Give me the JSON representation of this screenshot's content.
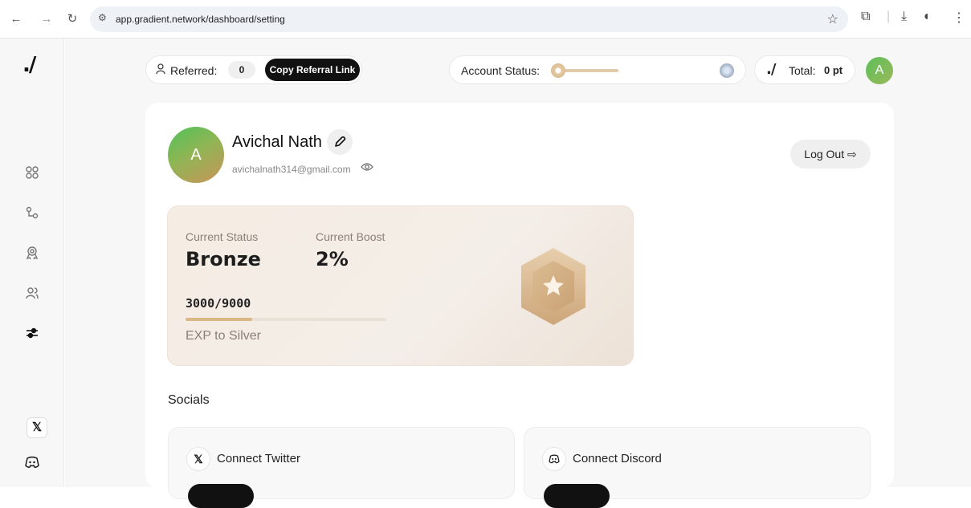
{
  "browser": {
    "url": "app.gradient.network/dashboard/setting",
    "icons": [
      "back-arrow-icon",
      "forward-arrow-icon",
      "reload-icon",
      "site-settings-icon",
      "bookmark-star-icon",
      "extensions-icon",
      "download-icon",
      "profile-icon",
      "menu-icon"
    ]
  },
  "sidebar": {
    "logo": "./",
    "items": [
      {
        "icon": "dashboard-grid-icon"
      },
      {
        "icon": "nodes-icon"
      },
      {
        "icon": "rewards-icon"
      },
      {
        "icon": "users-icon"
      },
      {
        "icon": "settings-sliders-icon",
        "active": true
      }
    ],
    "bottom": [
      {
        "icon": "x-icon",
        "glyph": "𝕏"
      },
      {
        "icon": "discord-icon"
      }
    ]
  },
  "topbar": {
    "referred_label": "Referred:",
    "referred_count": "0",
    "copy_link_label": "Copy Referral Link",
    "account_status_label": "Account Status:",
    "account_status_level": 0.05,
    "total_logo": "./",
    "total_label": "Total:",
    "total_value": "0 pt",
    "avatar_initial": "A"
  },
  "profile": {
    "avatar_initial": "A",
    "name": "Avichal Nath",
    "email": "avichalnath314@gmail.com",
    "logout_label": "Log Out ⇨"
  },
  "status_card": {
    "current_status_label": "Current Status",
    "current_status_value": "Bronze",
    "current_boost_label": "Current Boost",
    "current_boost_value": "2%",
    "progress_text": "3000/9000",
    "progress_fraction": 0.3333,
    "next_label": "EXP to Silver"
  },
  "socials": {
    "title": "Socials",
    "twitter": {
      "glyph": "𝕏",
      "label": "Connect Twitter"
    },
    "discord": {
      "label": "Connect Discord"
    }
  },
  "colors": {
    "accent_dark": "#111111",
    "bronze": "#d9b886",
    "avatar_green": "#5cc05a"
  }
}
